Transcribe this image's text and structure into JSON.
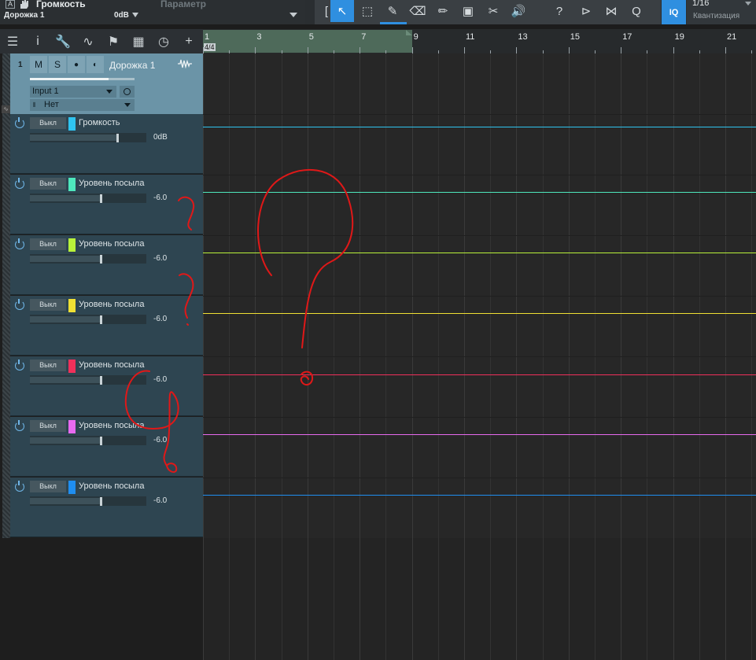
{
  "toolbar": {
    "a_icon": "A",
    "parameter_name": "Громкость",
    "parameter_label": "Параметр",
    "track_name": "Дорожка 1",
    "value": "0dB",
    "tools": [
      {
        "name": "bracket",
        "glyph": "["
      },
      {
        "name": "arrow-tool-icon",
        "glyph": "↖",
        "active": true
      },
      {
        "name": "range-tool-icon",
        "glyph": "⬚"
      },
      {
        "name": "paint-tool-icon",
        "glyph": "✎"
      },
      {
        "name": "eraser-tool-icon",
        "glyph": "⌫"
      },
      {
        "name": "draw-tool-icon",
        "glyph": "✏"
      },
      {
        "name": "mute-tool-icon",
        "glyph": "▣"
      },
      {
        "name": "split-tool-icon",
        "glyph": "✂"
      },
      {
        "name": "listen-tool-icon",
        "glyph": "🔊"
      },
      {
        "name": "help-icon",
        "glyph": "?"
      },
      {
        "name": "bend-marker-icon",
        "glyph": "⊳"
      },
      {
        "name": "bend-slice-icon",
        "glyph": "⋈"
      },
      {
        "name": "quantize-q-icon",
        "glyph": "Q"
      }
    ],
    "iq_label": "IQ",
    "quantize_value": "1/16",
    "quantize_label": "Квантизация",
    "active_color": "#2f8fe0"
  },
  "header_toolbar": [
    {
      "name": "list-icon",
      "glyph": "☰"
    },
    {
      "name": "info-icon",
      "glyph": "i"
    },
    {
      "name": "wrench-icon",
      "glyph": "🔧"
    },
    {
      "name": "automation-icon",
      "glyph": "∿"
    },
    {
      "name": "flag-icon",
      "glyph": "⚑"
    },
    {
      "name": "grid-icon",
      "glyph": "▦"
    },
    {
      "name": "clock-icon",
      "glyph": "◷"
    },
    {
      "name": "add-icon",
      "glyph": "+"
    }
  ],
  "ruler": {
    "labels": [
      "1",
      "3",
      "5",
      "7",
      "9",
      "11",
      "13",
      "15",
      "17",
      "19",
      "21"
    ],
    "time_signature": "4/4"
  },
  "track": {
    "number": "1",
    "mute": "M",
    "solo": "S",
    "record_glyph": "●",
    "monitor_glyph": "◐",
    "name": "Дорожка 1",
    "input": "Input 1",
    "output": "Нет",
    "volume_fraction": 0.75,
    "color": "#6b94a7"
  },
  "lanes": [
    {
      "off": "Выкл",
      "name": "Громкость",
      "value": "0dB",
      "color": "#2fc4f0",
      "slider": 0.74
    },
    {
      "off": "Выкл",
      "name": "Уровень посыла",
      "value": "-6.0",
      "color": "#4ee8bd",
      "slider": 0.6
    },
    {
      "off": "Выкл",
      "name": "Уровень посыла",
      "value": "-6.0",
      "color": "#b9f23a",
      "slider": 0.6
    },
    {
      "off": "Выкл",
      "name": "Уровень посыла",
      "value": "-6.0",
      "color": "#f0e034",
      "slider": 0.6
    },
    {
      "off": "Выкл",
      "name": "Уровень посыла",
      "value": "-6.0",
      "color": "#f0305a",
      "slider": 0.6
    },
    {
      "off": "Выкл",
      "name": "Уровень посыла",
      "value": "-6.0",
      "color": "#e86af0",
      "slider": 0.6
    },
    {
      "off": "Выкл",
      "name": "Уровень посыла",
      "value": "-6.0",
      "color": "#1f8ef0",
      "slider": 0.6
    }
  ]
}
